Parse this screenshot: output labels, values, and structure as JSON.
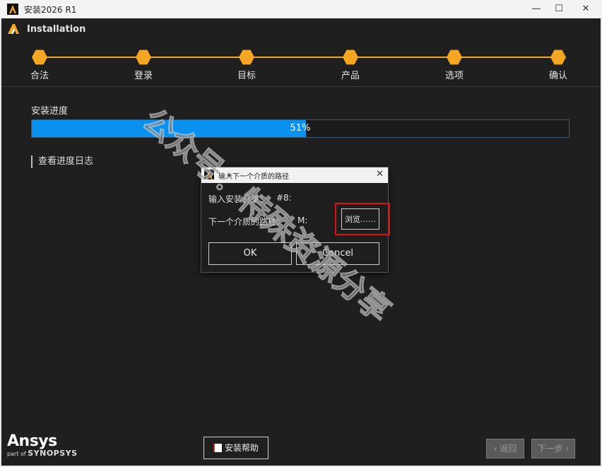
{
  "window": {
    "title": "安装2026 R1",
    "controls": {
      "minimize": "—",
      "maximize": "☐",
      "close": "✕"
    }
  },
  "header": {
    "app_name": "Installation"
  },
  "steps": [
    {
      "label": "合法"
    },
    {
      "label": "登录"
    },
    {
      "label": "目标"
    },
    {
      "label": "产品"
    },
    {
      "label": "选项"
    },
    {
      "label": "确认"
    }
  ],
  "progress": {
    "label": "安装进度",
    "value_percent": 51,
    "text": "51%"
  },
  "log_link": "查看进度日志",
  "dialog": {
    "title": "输入下一个介质的路径",
    "close": "✕",
    "install_dir_label": "输入安装目录：",
    "install_dir_value": "#8:",
    "next_media_label": "下一个介质的路径：",
    "next_media_value": "M:",
    "browse_label": "浏览……",
    "ok_label": "OK",
    "cancel_label": "Cancel"
  },
  "footer": {
    "brand": "Ansys",
    "brand_sub_prefix": "part of",
    "brand_sub": "SYNOPSYS",
    "help_label": "安装帮助",
    "back_label": "返回",
    "next_label": "下一步"
  },
  "watermark": {
    "text": "公众号：特殊资源分享"
  },
  "colors": {
    "accent": "#f5a623",
    "progress": "#0a91f0",
    "background": "#1f1f1f",
    "highlight": "#e01010"
  }
}
